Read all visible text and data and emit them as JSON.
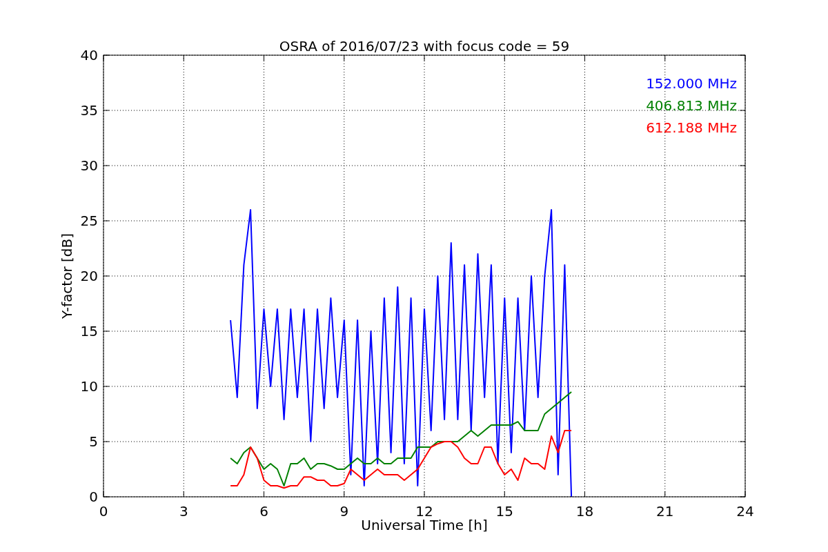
{
  "chart_data": {
    "type": "line",
    "grid": true,
    "title": "OSRA of 2016/07/23 with focus code = 59",
    "xlabel": "Universal Time [h]",
    "ylabel": "Y-factor [dB]",
    "xlim": [
      0,
      24
    ],
    "ylim": [
      0,
      40
    ],
    "xticks": [
      0,
      3,
      6,
      9,
      12,
      15,
      18,
      21,
      24
    ],
    "yticks": [
      0,
      5,
      10,
      15,
      20,
      25,
      30,
      35,
      40
    ],
    "x": [
      4.75,
      5.0,
      5.25,
      5.5,
      5.75,
      6.0,
      6.25,
      6.5,
      6.75,
      7.0,
      7.25,
      7.5,
      7.75,
      8.0,
      8.25,
      8.5,
      8.75,
      9.0,
      9.25,
      9.5,
      9.75,
      10.0,
      10.25,
      10.5,
      10.75,
      11.0,
      11.25,
      11.5,
      11.75,
      12.0,
      12.25,
      12.5,
      12.75,
      13.0,
      13.25,
      13.5,
      13.75,
      14.0,
      14.25,
      14.5,
      14.75,
      15.0,
      15.25,
      15.5,
      15.75,
      16.0,
      16.25,
      16.5,
      16.75,
      17.0,
      17.25,
      17.5
    ],
    "series": [
      {
        "name": "152.000 MHz",
        "color": "#0000ff",
        "values": [
          16,
          9,
          21,
          26,
          8,
          17,
          10,
          17,
          7,
          17,
          9,
          17,
          5,
          17,
          8,
          18,
          9,
          16,
          2,
          16,
          1,
          15,
          3,
          18,
          4,
          19,
          3,
          18,
          1,
          17,
          6,
          20,
          7,
          23,
          7,
          21,
          6,
          22,
          9,
          21,
          3,
          18,
          4,
          18,
          6,
          20,
          9,
          20,
          26,
          2,
          21,
          0
        ]
      },
      {
        "name": "406.813 MHz",
        "color": "#008000",
        "values": [
          3.5,
          3,
          4,
          4.5,
          3.5,
          2.5,
          3,
          2.5,
          1,
          3,
          3,
          3.5,
          2.5,
          3,
          3,
          2.8,
          2.5,
          2.5,
          3,
          3.5,
          3,
          3,
          3.5,
          3,
          3,
          3.5,
          3.5,
          3.5,
          4.5,
          4.5,
          4.5,
          5,
          5,
          5,
          5,
          5.5,
          6,
          5.5,
          6,
          6.5,
          6.5,
          6.5,
          6.5,
          6.8,
          6,
          6,
          6,
          7.5,
          8,
          8.5,
          9,
          9.5
        ]
      },
      {
        "name": "612.188 MHz",
        "color": "#ff0000",
        "values": [
          1,
          1,
          2,
          4.5,
          3.5,
          1.5,
          1,
          1,
          0.8,
          1,
          1,
          1.8,
          1.8,
          1.5,
          1.5,
          1,
          1,
          1.2,
          2.5,
          2,
          1.5,
          2,
          2.5,
          2,
          2,
          2,
          1.5,
          2,
          2.5,
          3.5,
          4.5,
          4.8,
          5,
          5,
          4.5,
          3.5,
          3,
          3,
          4.5,
          4.5,
          3,
          2,
          2.5,
          1.5,
          3.5,
          3,
          3,
          2.5,
          5.5,
          4,
          6,
          6
        ]
      }
    ]
  }
}
